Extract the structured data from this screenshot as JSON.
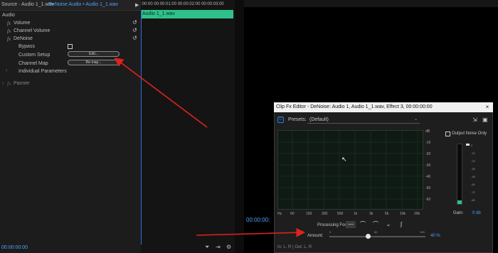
{
  "tabs": {
    "source": "Source · Audio 1_1.wav",
    "sequence": "DeNoise Audio • Audio 1_1.wav",
    "play_glyph": "▶"
  },
  "effect_controls": {
    "section": "Audio",
    "fx_badge": "fx",
    "volume": "Volume",
    "channel_volume": "Channel Volume",
    "denoise": "DeNoise",
    "bypass": "Bypass",
    "custom_setup": "Custom Setup",
    "edit_button": "Edit...",
    "channel_map": "Channel Map",
    "remap_button": "Re-map...",
    "individual_parameters": "Individual Parameters",
    "panner": "Panner",
    "timecode": "00:00:00:00",
    "reset_glyph": "↺"
  },
  "timeline": {
    "ruler": ":00:00    00:00:01:00    00:00:02:00    00:00:03:00",
    "clip": "Audio 1_1.wav"
  },
  "monitor": {
    "timecode": "00:00:00:"
  },
  "fx_editor": {
    "title": "Clip Fx Editor - DeNoise: Audio 1, Audio 1_1.wav, Effect 3, 00:00:00:00",
    "close_glyph": "×",
    "power_glyph": "⏻",
    "presets_label": "Presets:",
    "presets_value": "(Default)",
    "chevron": "⌄",
    "db_ticks": [
      "dB",
      "-10",
      "-20",
      "-30",
      "-40",
      "-50",
      "-60"
    ],
    "hz_ticks": [
      "Hz",
      "60",
      "100",
      "300",
      "500",
      "1k",
      "3k",
      "5k",
      "10k",
      "20k"
    ],
    "output_noise_only": "Output Noise Only",
    "meter_ticks": [
      "0",
      "-12",
      "-24",
      "-36",
      "-48",
      "-60",
      "-72",
      "-80"
    ],
    "gain_label": "Gain:",
    "gain_value": "0 db",
    "processing_focus_label": "Processing Focus:",
    "processing_focus_glyphs": [
      "—",
      "⌒",
      "⌒",
      "⌄",
      "∫"
    ],
    "amount_label": "Amount:",
    "amount_ticks": [
      "0",
      "50",
      "100"
    ],
    "amount_value": "40 %",
    "amount_fraction": 0.4,
    "io_text": "In: L, R | Out: L, R",
    "accent_color": "#4aa3ff"
  },
  "colors": {
    "clip_green": "#2ec28a",
    "annotation_red": "#e0221c"
  }
}
